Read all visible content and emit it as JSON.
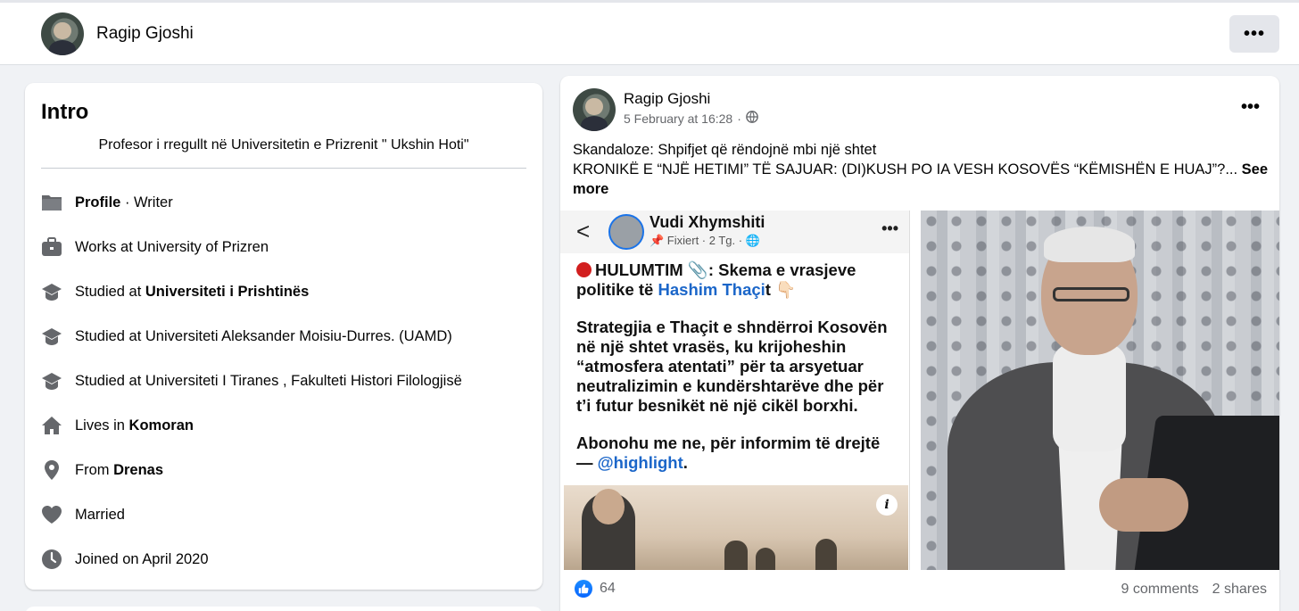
{
  "header": {
    "name": "Ragip Gjoshi",
    "more_label": "•••"
  },
  "intro": {
    "title": "Intro",
    "bio": "Profesor i rregullt në Universitetin e Prizrenit \" Ukshin Hoti\"",
    "items": [
      {
        "icon": "profile-icon",
        "pre": "",
        "bold": "Profile",
        "post": " · Writer"
      },
      {
        "icon": "work-icon",
        "pre": "Works at University of Prizren",
        "bold": "",
        "post": ""
      },
      {
        "icon": "education-icon",
        "pre": "Studied at ",
        "bold": "Universiteti i Prishtinës",
        "post": ""
      },
      {
        "icon": "education-icon",
        "pre": "Studied at Universiteti Aleksander Moisiu-Durres. (UAMD)",
        "bold": "",
        "post": ""
      },
      {
        "icon": "education-icon",
        "pre": "Studied at Universiteti I Tiranes , Fakulteti Histori Filologjisë",
        "bold": "",
        "post": ""
      },
      {
        "icon": "home-icon",
        "pre": "Lives in ",
        "bold": "Komoran",
        "post": ""
      },
      {
        "icon": "location-icon",
        "pre": "From ",
        "bold": "Drenas",
        "post": ""
      },
      {
        "icon": "heart-icon",
        "pre": "Married",
        "bold": "",
        "post": ""
      },
      {
        "icon": "clock-icon",
        "pre": "Joined on April 2020",
        "bold": "",
        "post": ""
      }
    ]
  },
  "post": {
    "author": "Ragip Gjoshi",
    "time": "5 February at 16:28",
    "separator": "·",
    "more_label": "•••",
    "text_line1": "Skandaloze: Shpifjet që rëndojnë mbi një shtet",
    "text_line2": "KRONIKË E “NJË HETIMI” TË SAJUAR: (DI)KUSH PO IA VESH KOSOVËS “KËMISHËN E HUAJ”?...",
    "see_more": "See more",
    "likes": "64",
    "comments": "9 comments",
    "shares": "2 shares",
    "embedded": {
      "back": "<",
      "name": "Vudi Xhymshiti",
      "sub": "📌 Fixiert · 2 Tg. · 🌐",
      "dots": "•••",
      "p1_a": "HULUMTIM 📎: Skema e vrasjeve politike të ",
      "p1_link": "Hashim Thaçi",
      "p1_b": "t 👇🏻",
      "p2": "Strategjia e Thaçit e shndërroi Kosovën në një shtet vrasës, ku krijoheshin “atmosfera atentati” për ta arsyetuar neutralizimin e kundërshtarëve dhe për t’i futur besnikët në një cikël borxhi.",
      "p3_a": "Abonohu me ne, për informim të drejtë — ",
      "p3_link": "@highlight",
      "p3_b": ".",
      "info": "i"
    }
  }
}
